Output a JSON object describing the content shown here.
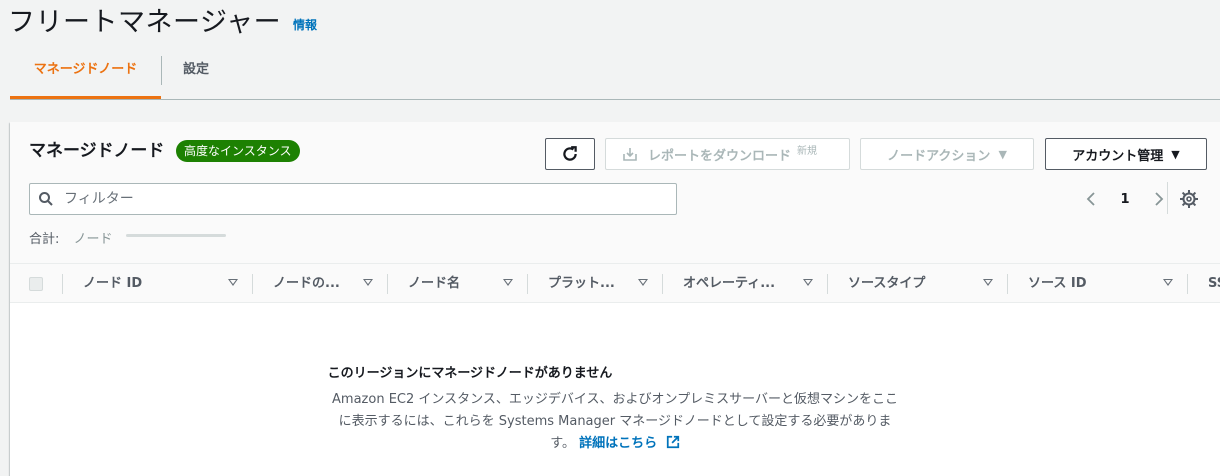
{
  "header": {
    "title": "フリートマネージャー",
    "info": "情報"
  },
  "tabs": [
    {
      "label": "マネージドノード",
      "active": true
    },
    {
      "label": "設定",
      "active": false
    }
  ],
  "panel": {
    "title": "マネージドノード",
    "badge": "高度なインスタンス",
    "refresh_icon": "refresh-icon",
    "report_button": "レポートをダウンロード",
    "report_new": "新規",
    "node_action_button": "ノードアクション",
    "account_button": "アカウント管理",
    "filter_placeholder": "フィルター",
    "page_number": "1",
    "total_label": "合計:",
    "total_value": "ノード"
  },
  "table": {
    "columns": [
      "ノード ID",
      "ノードの...",
      "ノード名",
      "プラット...",
      "オペレーティ...",
      "ソースタイプ",
      "ソース ID",
      "SS"
    ]
  },
  "empty_state": {
    "title": "このリージョンにマネージドノードがありません",
    "description": "Amazon EC2 インスタンス、エッジデバイス、およびオンプレミスサーバーと仮想マシンをここに表示するには、これらを Systems Manager マネージドノードとして設定する必要がありま す。",
    "description_line1": "Amazon EC2 インスタンス、エッジデバイス、およびオンプレミスサーバーと仮想マシンをここ",
    "description_line2": "に表示するには、これらを Systems Manager マネージドノードとして設定する必要がありま",
    "description_line3": "す。",
    "link": "詳細はこちら"
  },
  "colors": {
    "accent": "#ec7211",
    "link": "#0073bb",
    "badge": "#1d8102"
  }
}
